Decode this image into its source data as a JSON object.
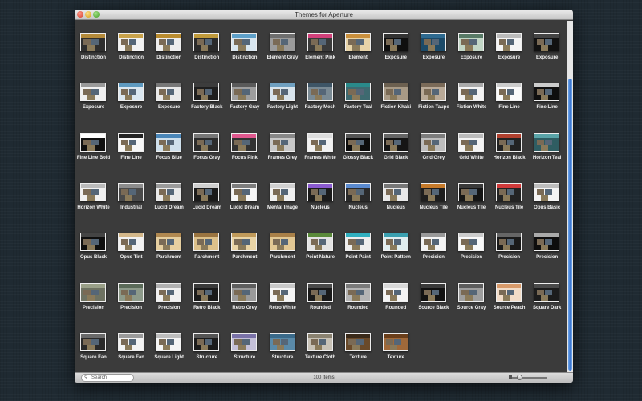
{
  "window": {
    "title": "Themes for Aperture"
  },
  "footer": {
    "search_placeholder": "Search",
    "item_count": "100 Items"
  },
  "themes": [
    {
      "label": "Distinction",
      "bg": "#2e2e2e",
      "band": "#b48a3a"
    },
    {
      "label": "Distinction",
      "bg": "#f2f2f2",
      "band": "#c9a24a"
    },
    {
      "label": "Distinction",
      "bg": "#ededed",
      "band": "#b98b2e"
    },
    {
      "label": "Distinction",
      "bg": "#2a2a2a",
      "band": "#c09a3b"
    },
    {
      "label": "Distinction",
      "bg": "#d9e6ef",
      "band": "#5ea0c9"
    },
    {
      "label": "Element Gray",
      "bg": "#9b9b9b",
      "band": "#6e6e6e"
    },
    {
      "label": "Element Pink",
      "bg": "#3a3a3a",
      "band": "#d2407a"
    },
    {
      "label": "Element",
      "bg": "#e6d3a8",
      "band": "#c98f3c"
    },
    {
      "label": "Exposure",
      "bg": "#0f0f0f",
      "band": "#333333"
    },
    {
      "label": "Exposure",
      "bg": "#1c4a68",
      "band": "#2e6a90"
    },
    {
      "label": "Exposure",
      "bg": "#c2d6c6",
      "band": "#587a66"
    },
    {
      "label": "Exposure",
      "bg": "#f5f5f5",
      "band": "#bbbbbb"
    },
    {
      "label": "Exposure",
      "bg": "#111111",
      "band": "#444444"
    },
    {
      "label": "Exposure",
      "bg": "#f0f0f0",
      "band": "#9a9a9a"
    },
    {
      "label": "Exposure",
      "bg": "#dbe7f0",
      "band": "#5e9ac0"
    },
    {
      "label": "Exposure",
      "bg": "#e9e9e9",
      "band": "#777777"
    },
    {
      "label": "Factory Black",
      "bg": "#1e1e1e",
      "band": "#3c3c3c"
    },
    {
      "label": "Factory Gray",
      "bg": "#9e9e9e",
      "band": "#5a5a5a"
    },
    {
      "label": "Factory Light",
      "bg": "#d8e4ec",
      "band": "#6fa0c0"
    },
    {
      "label": "Factory Mesh",
      "bg": "#7a8a94",
      "band": "#3e5566"
    },
    {
      "label": "Factory Teal",
      "bg": "#3e6a70",
      "band": "#2a8a8a"
    },
    {
      "label": "Fiction Khaki",
      "bg": "#a89a86",
      "band": "#6c6050"
    },
    {
      "label": "Fiction Taupe",
      "bg": "#b9aa98",
      "band": "#7a6a58"
    },
    {
      "label": "Fiction White",
      "bg": "#f3f3f3",
      "band": "#aaaaaa"
    },
    {
      "label": "Fine Line",
      "bg": "#fafafa",
      "band": "#cccccc"
    },
    {
      "label": "Fine Line",
      "bg": "#0e0e0e",
      "band": "#cccccc"
    },
    {
      "label": "Fine Line Bold",
      "bg": "#101010",
      "band": "#ffffff"
    },
    {
      "label": "Fine Line",
      "bg": "#f7f7f7",
      "band": "#222222"
    },
    {
      "label": "Focus Blue",
      "bg": "#cfe0ec",
      "band": "#4a86b8"
    },
    {
      "label": "Focus Gray",
      "bg": "#2c2c2c",
      "band": "#777777"
    },
    {
      "label": "Focus Pink",
      "bg": "#323232",
      "band": "#e0588e"
    },
    {
      "label": "Frames Grey",
      "bg": "#c8c8c8",
      "band": "#888888"
    },
    {
      "label": "Frames White",
      "bg": "#f2f2f2",
      "band": "#dddddd"
    },
    {
      "label": "Glossy Black",
      "bg": "#0c0c0c",
      "band": "#555555"
    },
    {
      "label": "Grid Black",
      "bg": "#151515",
      "band": "#666666"
    },
    {
      "label": "Grid Grey",
      "bg": "#bdbdbd",
      "band": "#7c7c7c"
    },
    {
      "label": "Grid White",
      "bg": "#f4f4f4",
      "band": "#bbbbbb"
    },
    {
      "label": "Horizon Black",
      "bg": "#222222",
      "band": "#b0402e"
    },
    {
      "label": "Horizon Teal",
      "bg": "#2f5d62",
      "band": "#5aa4a8"
    },
    {
      "label": "Horizon White",
      "bg": "#f1f1f1",
      "band": "#bbbbbb"
    },
    {
      "label": "Industrial",
      "bg": "#4a4a4a",
      "band": "#8c8c8c"
    },
    {
      "label": "Lucid Dream",
      "bg": "#e9e9e9",
      "band": "#9a9a9a"
    },
    {
      "label": "Lucid Dream",
      "bg": "#1a1a1a",
      "band": "#cfcfcf"
    },
    {
      "label": "Lucid Dream",
      "bg": "#f6f6f6",
      "band": "#7d7d7d"
    },
    {
      "label": "Mental Image",
      "bg": "#f0f0f0",
      "band": "#d0d0d0"
    },
    {
      "label": "Nucleus",
      "bg": "#1b1b1b",
      "band": "#8a5acf"
    },
    {
      "label": "Nucleus",
      "bg": "#2a2a2a",
      "band": "#5a8acf"
    },
    {
      "label": "Nucleus",
      "bg": "#e8e8e8",
      "band": "#777777"
    },
    {
      "label": "Nucleus Tile",
      "bg": "#1e1e1e",
      "band": "#c67a2a"
    },
    {
      "label": "Nucleus Tile",
      "bg": "#151515",
      "band": "#3a3a3a"
    },
    {
      "label": "Nucleus Tile",
      "bg": "#232323",
      "band": "#d03a3a"
    },
    {
      "label": "Opus Basic",
      "bg": "#f4f4f4",
      "band": "#bdbdbd"
    },
    {
      "label": "Opus Black",
      "bg": "#0f0f0f",
      "band": "#444444"
    },
    {
      "label": "Opus Tint",
      "bg": "#f2f2f2",
      "band": "#d4b88a"
    },
    {
      "label": "Parchment",
      "bg": "#e6cfa0",
      "band": "#b08850"
    },
    {
      "label": "Parchment",
      "bg": "#dcc08a",
      "band": "#9a7440"
    },
    {
      "label": "Parchment",
      "bg": "#e9d4a6",
      "band": "#c09a5a"
    },
    {
      "label": "Parchment",
      "bg": "#e2c894",
      "band": "#a98048"
    },
    {
      "label": "Point Nature",
      "bg": "#e3e3e3",
      "band": "#5a8a3a"
    },
    {
      "label": "Point Paint",
      "bg": "#eeeeee",
      "band": "#30b0c0"
    },
    {
      "label": "Point Pattern",
      "bg": "#e0eef0",
      "band": "#3aa0b0"
    },
    {
      "label": "Precision",
      "bg": "#f4f4f4",
      "band": "#999999"
    },
    {
      "label": "Precision",
      "bg": "#f9f9f9",
      "band": "#cccccc"
    },
    {
      "label": "Precision",
      "bg": "#1a1a1a",
      "band": "#666666"
    },
    {
      "label": "Precision",
      "bg": "#0d0d0d",
      "band": "#aaaaaa"
    },
    {
      "label": "Precision",
      "bg": "#6e7262",
      "band": "#9aa088"
    },
    {
      "label": "Precision",
      "bg": "#8d9a8a",
      "band": "#5a6a58"
    },
    {
      "label": "Precision",
      "bg": "#f0f0f0",
      "band": "#b0b0b0"
    },
    {
      "label": "Retro Black",
      "bg": "#1a1a1a",
      "band": "#3a3a3a"
    },
    {
      "label": "Retro Grey",
      "bg": "#9a9a9a",
      "band": "#5e5e5e"
    },
    {
      "label": "Retro White",
      "bg": "#f4f4f4",
      "band": "#c8c8c8"
    },
    {
      "label": "Rounded",
      "bg": "#1a1a1a",
      "band": "#4a4a4a"
    },
    {
      "label": "Rounded",
      "bg": "#b4b4b4",
      "band": "#7a7a7a"
    },
    {
      "label": "Rounded",
      "bg": "#f4f4f4",
      "band": "#d8d8d8"
    },
    {
      "label": "Source Black",
      "bg": "#121212",
      "band": "#3a3a3a"
    },
    {
      "label": "Source Gray",
      "bg": "#9e9e9e",
      "band": "#5c5c5c"
    },
    {
      "label": "Source Peach",
      "bg": "#f2dcc8",
      "band": "#d89a6a"
    },
    {
      "label": "Square Dark",
      "bg": "#1c1c1c",
      "band": "#4a4a4a"
    },
    {
      "label": "Square Fan",
      "bg": "#2a2a2a",
      "band": "#6a6a6a"
    },
    {
      "label": "Square Fan",
      "bg": "#f3f3f3",
      "band": "#9a9a9a"
    },
    {
      "label": "Square Light",
      "bg": "#f5f5f5",
      "band": "#bdbdbd"
    },
    {
      "label": "Structure",
      "bg": "#1b1b1b",
      "band": "#555555"
    },
    {
      "label": "Structure",
      "bg": "#c4c0d8",
      "band": "#7a72a8"
    },
    {
      "label": "Structure",
      "bg": "#5a8aa8",
      "band": "#3a6a8a"
    },
    {
      "label": "Texture Cloth",
      "bg": "#c8c2b6",
      "band": "#8a8270"
    },
    {
      "label": "Texture",
      "bg": "#6a4a2a",
      "band": "#3a2a1a"
    },
    {
      "label": "Texture",
      "bg": "#a0693a",
      "band": "#6a3e1a"
    }
  ]
}
